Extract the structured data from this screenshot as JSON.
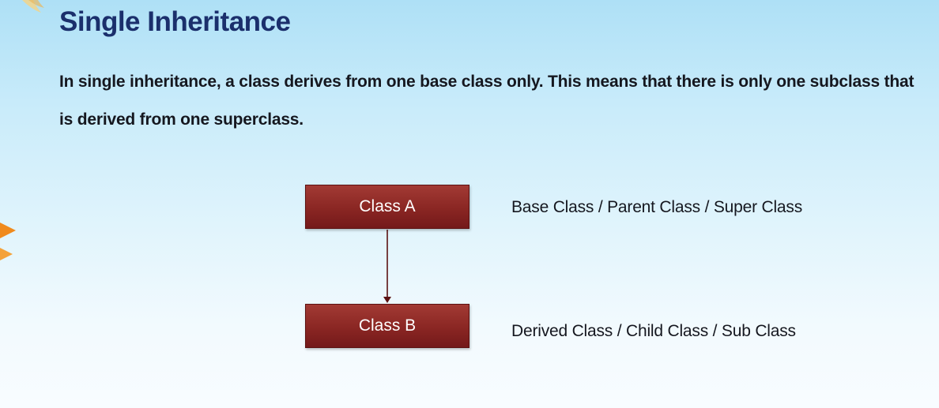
{
  "slide": {
    "title": "Single Inheritance",
    "description": "In single inheritance, a class derives from one base class only. This means that there is only one subclass that is derived from one superclass."
  },
  "diagram": {
    "nodes": [
      {
        "id": "class-a",
        "label": "Class A",
        "description": "Base Class / Parent Class / Super Class"
      },
      {
        "id": "class-b",
        "label": "Class B",
        "description": "Derived Class / Child Class / Sub Class"
      }
    ],
    "edges": [
      {
        "from": "class-a",
        "to": "class-b",
        "style": "arrow"
      }
    ]
  },
  "colors": {
    "title": "#1b2f6c",
    "box_fill": "#8a2623",
    "arrow": "#5c1212",
    "text": "#15171f"
  }
}
